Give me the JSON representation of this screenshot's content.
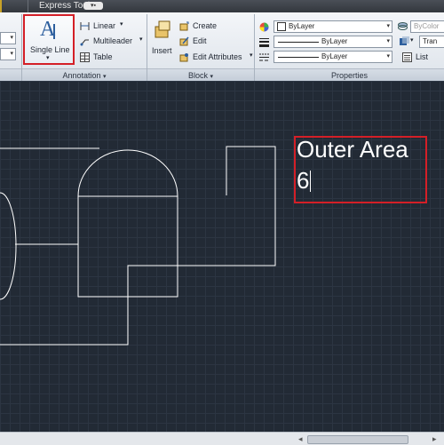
{
  "tabstrip": {
    "express_tools_label": "Express Tools"
  },
  "annotation": {
    "single_line_label": "Single Line",
    "linear_label": "Linear",
    "multileader_label": "Multileader",
    "table_label": "Table",
    "panel_title": "Annotation"
  },
  "block": {
    "insert_label": "Insert",
    "create_label": "Create",
    "edit_label": "Edit",
    "edit_attributes_label": "Edit Attributes",
    "panel_title": "Block"
  },
  "properties": {
    "color_value": "ByLayer",
    "linetype_value": "ByLayer",
    "lineweight_value": "ByLayer",
    "bycolor_value": "ByColor",
    "transparency_value": "Tran",
    "list_label": "List",
    "panel_title": "Properties"
  },
  "canvas": {
    "text_line_1": "Outer Area",
    "text_line_2": "6"
  },
  "colors": {
    "canvas_bg": "#222a35",
    "highlight_red": "#d41f27",
    "drawing_lines": "#ffffff"
  }
}
